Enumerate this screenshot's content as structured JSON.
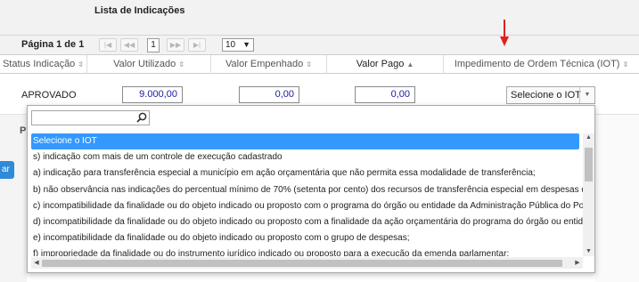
{
  "panel": {
    "title": "Lista de Indicações"
  },
  "pager": {
    "page_label": "Página 1 de 1",
    "current_page": "1",
    "page_size": "10",
    "first_icon": "first-page-icon",
    "prev_icon": "prev-page-icon",
    "next_icon": "next-page-icon",
    "last_icon": "last-page-icon"
  },
  "table": {
    "columns": [
      {
        "label": "Status Indicação",
        "sort": "⇳"
      },
      {
        "label": "Valor Utilizado",
        "sort": "⇳"
      },
      {
        "label": "Valor Empenhado",
        "sort": "⇳"
      },
      {
        "label": "Valor Pago",
        "sort": "▲"
      },
      {
        "label": "Impedimento de Ordem Técnica (IOT)",
        "sort": "⇳"
      }
    ],
    "row": {
      "status": "APROVADO",
      "valor_utilizado": "9.000,00",
      "valor_empenhado": "0,00",
      "valor_pago": "0,00",
      "iot_selected": "Selecione o IOT"
    }
  },
  "background": {
    "partial_label": "P",
    "partial_button": "ar"
  },
  "dropdown": {
    "search_value": "",
    "options": [
      "Selecione o IOT",
      "s) indicação com mais de um controle de execução cadastrado",
      "a) indicação para transferência especial a município em ação orçamentária que não permita essa modalidade de transferência;",
      "b) não observância nas indicações do percentual mínimo de 70% (setenta por cento) dos recursos de transferência especial em despesas de capital;",
      "c) incompatibilidade da finalidade ou do objeto indicado ou proposto com o programa do órgão ou entidade da Administração Pública do Poder Executivo;",
      "d) incompatibilidade da finalidade ou do objeto indicado ou proposto com a finalidade da ação orçamentária do programa do órgão ou entidade da Administração Pública;",
      "e) incompatibilidade da finalidade ou do objeto indicado ou proposto com o grupo de despesas;",
      "f) impropriedade da finalidade ou do instrumento jurídico indicado ou proposto para a execução da emenda parlamentar;"
    ]
  },
  "colors": {
    "selected_option": "#3399ff",
    "annotation_arrow": "#e02020",
    "input_value_text": "#1a1aa6"
  }
}
